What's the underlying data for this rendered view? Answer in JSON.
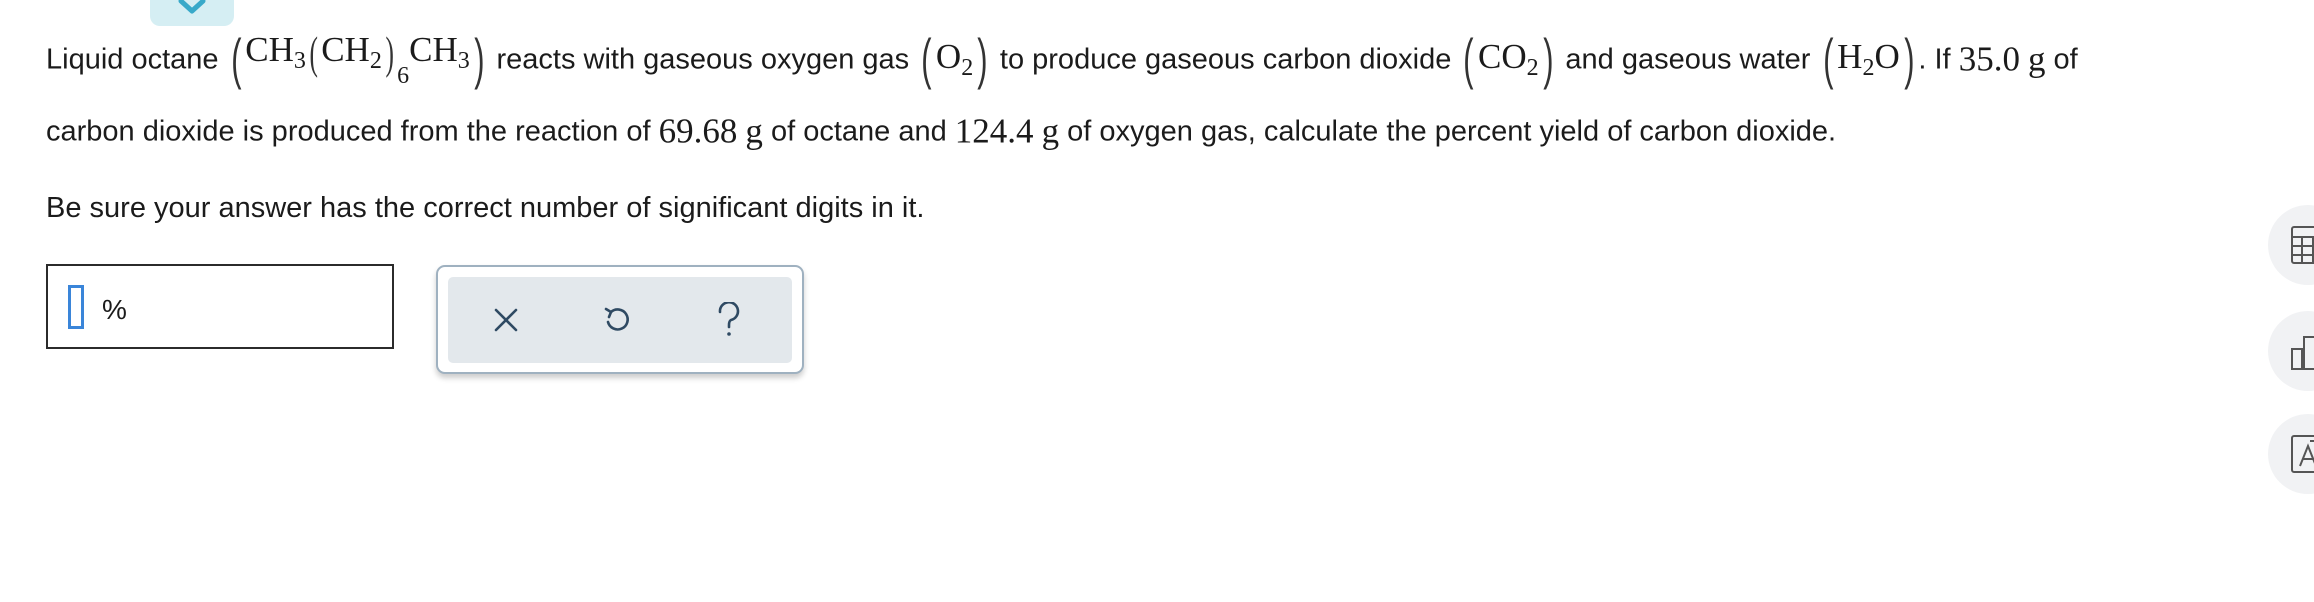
{
  "question": {
    "line1": {
      "t1": "Liquid octane ",
      "octane": {
        "a": "CH",
        "s1": "3",
        "b": "CH",
        "s2": "2",
        "n": "6",
        "c": "CH",
        "s3": "3"
      },
      "t2": " reacts with gaseous oxygen gas ",
      "oxygen": {
        "a": "O",
        "s": "2"
      },
      "t3": " to produce gaseous carbon dioxide ",
      "co2": {
        "a": "CO",
        "s": "2"
      },
      "t4": " and gaseous water ",
      "water": {
        "a": "H",
        "s": "2",
        "b": "O"
      },
      "t5": ". If ",
      "mass_co2": "35.0",
      "unit_g": "g",
      "t6": " of"
    },
    "line2": {
      "t1": "carbon dioxide is produced from the reaction of ",
      "mass_octane": "69.68",
      "unit_g1": "g",
      "t2": " of octane and ",
      "mass_oxygen": "124.4",
      "unit_g2": "g",
      "t3": " of oxygen gas, calculate the percent yield of carbon dioxide."
    },
    "note": "Be sure your answer has the correct number of significant digits in it."
  },
  "answer": {
    "value": "",
    "unit": "%"
  },
  "tools": {
    "clear": "clear-x-icon",
    "undo": "undo-icon",
    "help": "help-question-icon"
  },
  "sidebar": {
    "calculator": "calculator-icon",
    "data": "chart-icon",
    "periodic": "periodic-table-icon"
  },
  "colors": {
    "cursor": "#3a85d9",
    "tool_icon": "#2f4a63",
    "tool_bg": "#e3e8ec",
    "tab_bg": "#d5eef3"
  }
}
